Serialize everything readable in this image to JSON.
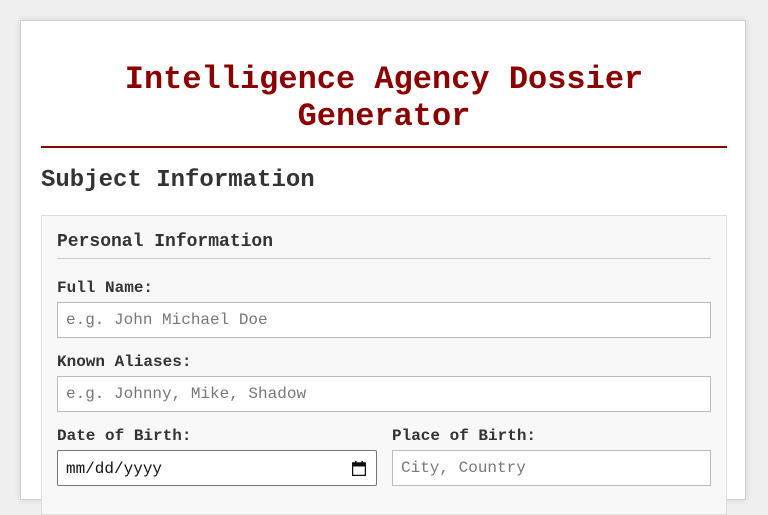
{
  "header": {
    "title": "Intelligence Agency Dossier Generator"
  },
  "section": {
    "title": "Subject Information"
  },
  "personal_info": {
    "title": "Personal Information",
    "full_name": {
      "label": "Full Name:",
      "value": "",
      "placeholder": "e.g. John Michael Doe"
    },
    "aliases": {
      "label": "Known Aliases:",
      "value": "",
      "placeholder": "e.g. Johnny, Mike, Shadow"
    },
    "dob": {
      "label": "Date of Birth:",
      "value": "",
      "display": "mm/dd/yyyy",
      "icon": "calendar-icon"
    },
    "pob": {
      "label": "Place of Birth:",
      "value": "",
      "placeholder": "City, Country"
    }
  },
  "colors": {
    "accent": "#8b0000",
    "text": "#333333",
    "fieldset_bg": "#f8f8f8"
  }
}
